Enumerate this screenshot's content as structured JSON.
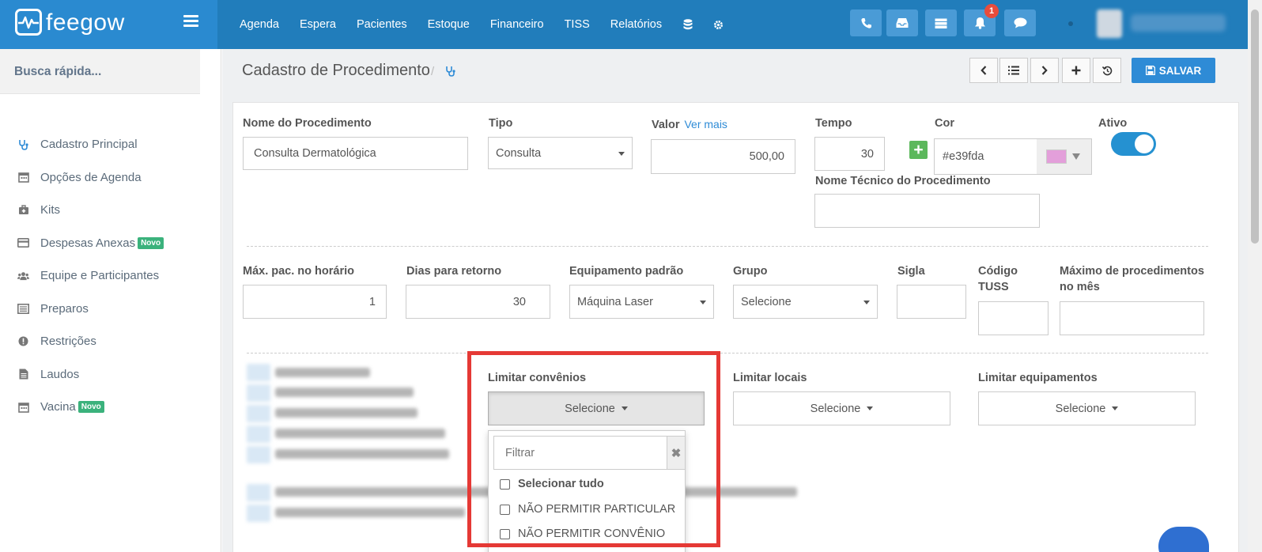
{
  "app": {
    "brand": "feegow",
    "nav": [
      "Agenda",
      "Espera",
      "Pacientes",
      "Estoque",
      "Financeiro",
      "TISS",
      "Relatórios"
    ],
    "notification_count": "1"
  },
  "sidebar": {
    "quick_search": "Busca rápida...",
    "items": [
      {
        "label": "Cadastro Principal",
        "icon": "stethoscope-icon"
      },
      {
        "label": "Opções de Agenda",
        "icon": "calendar-icon"
      },
      {
        "label": "Kits",
        "icon": "medkit-icon"
      },
      {
        "label": "Despesas Anexas",
        "icon": "credit-card-icon",
        "badge": "Novo"
      },
      {
        "label": "Equipe e Participantes",
        "icon": "users-icon"
      },
      {
        "label": "Preparos",
        "icon": "list-alt-icon"
      },
      {
        "label": "Restrições",
        "icon": "exclamation-circle-icon"
      },
      {
        "label": "Laudos",
        "icon": "file-text-icon"
      },
      {
        "label": "Vacina",
        "icon": "calendar-icon",
        "badge": "Novo"
      }
    ]
  },
  "header": {
    "title": "Cadastro de Procedimento",
    "breadcrumb_sep": "/",
    "save_label": "SALVAR"
  },
  "form": {
    "nome": {
      "label": "Nome do Procedimento",
      "value": "Consulta Dermatológica"
    },
    "tipo": {
      "label": "Tipo",
      "value": "Consulta"
    },
    "valor": {
      "label": "Valor",
      "link": "Ver mais",
      "value": "500,00"
    },
    "tempo": {
      "label": "Tempo",
      "value": "30"
    },
    "cor": {
      "label": "Cor",
      "value": "#e39fda"
    },
    "ativo": {
      "label": "Ativo",
      "on": true
    },
    "nome_tecnico": {
      "label": "Nome Técnico do Procedimento",
      "value": ""
    },
    "max_pac": {
      "label": "Máx. pac. no horário",
      "value": "1"
    },
    "dias_retorno": {
      "label": "Dias para retorno",
      "value": "30"
    },
    "equipamento": {
      "label": "Equipamento padrão",
      "value": "Máquina Laser"
    },
    "grupo": {
      "label": "Grupo",
      "value": "Selecione"
    },
    "sigla": {
      "label": "Sigla",
      "value": ""
    },
    "codigo_tuss": {
      "label_line1": "Código",
      "label_line2": "TUSS",
      "value": ""
    },
    "max_proc_mes": {
      "label_line1": "Máximo de procedimentos",
      "label_line2": "no mês",
      "value": ""
    },
    "limitar_convenios": {
      "label": "Limitar convênios",
      "button": "Selecione"
    },
    "limitar_locais": {
      "label": "Limitar locais",
      "button": "Selecione"
    },
    "limitar_equipamentos": {
      "label": "Limitar equipamentos",
      "button": "Selecione"
    }
  },
  "dropdown": {
    "filter_placeholder": "Filtrar",
    "options": [
      "Selecionar tudo",
      "NÃO PERMITIR PARTICULAR",
      "NÃO PERMITIR CONVÊNIO"
    ]
  }
}
